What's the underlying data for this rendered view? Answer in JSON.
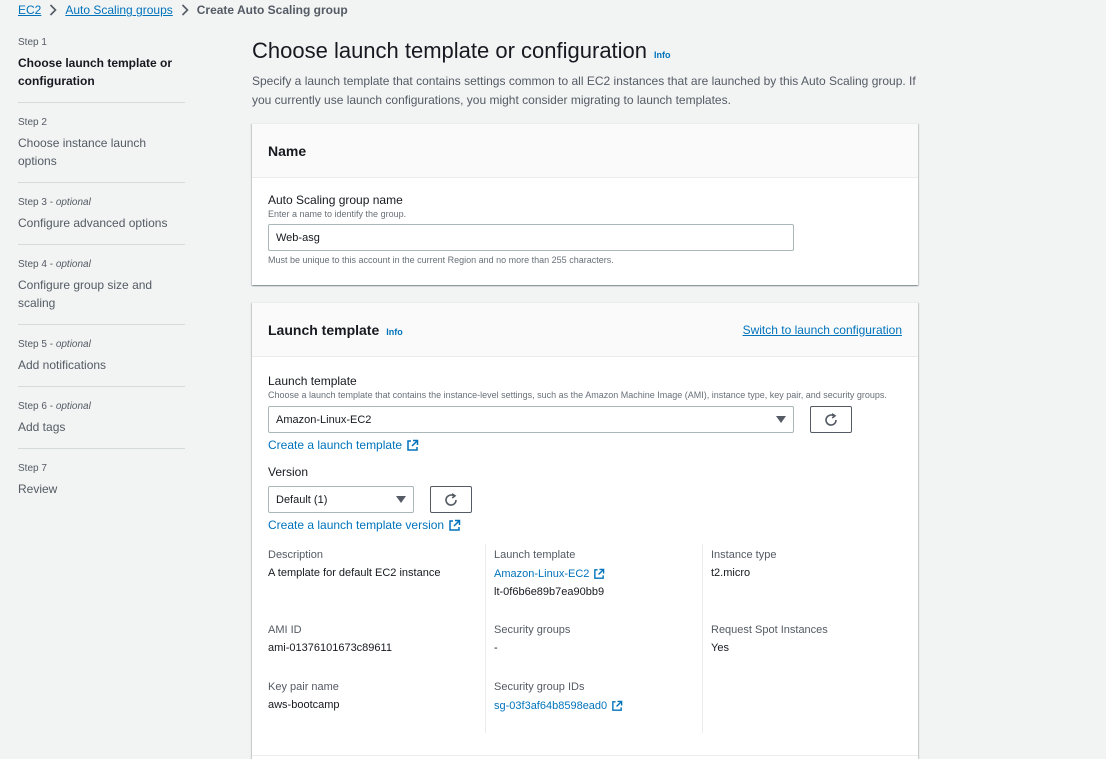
{
  "breadcrumb": {
    "items": [
      "EC2",
      "Auto Scaling groups"
    ],
    "current": "Create Auto Scaling group"
  },
  "steps": [
    {
      "num": "Step 1",
      "optional": "",
      "title": "Choose launch template or configuration"
    },
    {
      "num": "Step 2",
      "optional": "",
      "title": "Choose instance launch options"
    },
    {
      "num": "Step 3",
      "optional": "optional",
      "title": "Configure advanced options"
    },
    {
      "num": "Step 4",
      "optional": "optional",
      "title": "Configure group size and scaling"
    },
    {
      "num": "Step 5",
      "optional": "optional",
      "title": "Add notifications"
    },
    {
      "num": "Step 6",
      "optional": "optional",
      "title": "Add tags"
    },
    {
      "num": "Step 7",
      "optional": "",
      "title": "Review"
    }
  ],
  "page": {
    "title": "Choose launch template or configuration",
    "info": "Info",
    "description": "Specify a launch template that contains settings common to all EC2 instances that are launched by this Auto Scaling group. If you currently use launch configurations, you might consider migrating to launch templates."
  },
  "name_card": {
    "title": "Name",
    "label": "Auto Scaling group name",
    "description": "Enter a name to identify the group.",
    "value": "Web-asg",
    "constraint": "Must be unique to this account in the current Region and no more than 255 characters."
  },
  "template_card": {
    "title": "Launch template",
    "info": "Info",
    "switch_link": "Switch to launch configuration",
    "label": "Launch template",
    "description": "Choose a launch template that contains the instance-level settings, such as the Amazon Machine Image (AMI), instance type, key pair, and security groups.",
    "selected": "Amazon-Linux-EC2",
    "create_link": "Create a launch template",
    "version_label": "Version",
    "version_selected": "Default (1)",
    "create_version_link": "Create a launch template version",
    "details": {
      "description_label": "Description",
      "description_value": "A template for default EC2 instance",
      "lt_label": "Launch template",
      "lt_name": "Amazon-Linux-EC2",
      "lt_id": "lt-0f6b6e89b7ea90bb9",
      "type_label": "Instance type",
      "type_value": "t2.micro",
      "ami_label": "AMI ID",
      "ami_value": "ami-01376101673c89611",
      "sg_label": "Security groups",
      "sg_value": "-",
      "spot_label": "Request Spot Instances",
      "spot_value": "Yes",
      "key_label": "Key pair name",
      "key_value": "aws-bootcamp",
      "sgid_label": "Security group IDs",
      "sgid_value": "sg-03f3af64b8598ead0"
    }
  },
  "colors": {
    "link": "#0073bb",
    "background": "#f2f3f3",
    "text": "#16191f",
    "muted": "#545b64"
  }
}
